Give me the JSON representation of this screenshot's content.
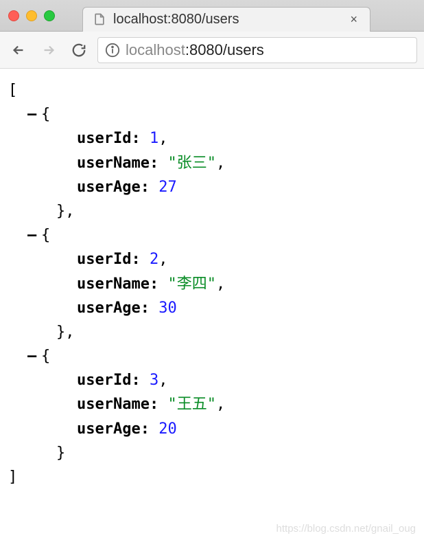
{
  "browser": {
    "tab_title": "localhost:8080/users",
    "url_grey": "localhost",
    "url_rest": ":8080/users",
    "close_glyph": "×"
  },
  "json": {
    "open_bracket": "[",
    "close_bracket": "]",
    "toggle_glyph": "–",
    "obj_open": "{",
    "obj_close_comma": "},",
    "obj_close": "}",
    "items": [
      {
        "userId_key": "userId",
        "userId_val": "1",
        "userName_key": "userName",
        "userName_val": "\"张三\"",
        "userAge_key": "userAge",
        "userAge_val": "27"
      },
      {
        "userId_key": "userId",
        "userId_val": "2",
        "userName_key": "userName",
        "userName_val": "\"李四\"",
        "userAge_key": "userAge",
        "userAge_val": "30"
      },
      {
        "userId_key": "userId",
        "userId_val": "3",
        "userName_key": "userName",
        "userName_val": "\"王五\"",
        "userAge_key": "userAge",
        "userAge_val": "20"
      }
    ],
    "colon": ": ",
    "comma": ","
  },
  "watermark": "https://blog.csdn.net/gnail_oug"
}
